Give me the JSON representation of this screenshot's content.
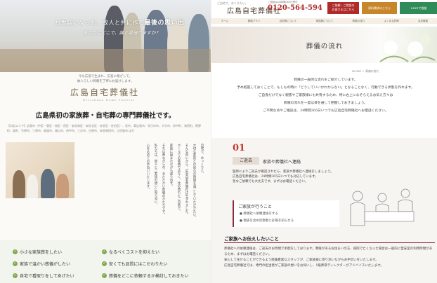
{
  "left": {
    "hero_copy_pre": "お世話になった、故人と共に作る",
    "hero_copy_em": "最後の思い出",
    "hero_copy_sub": "あなたはどこで、誰と見送りますか？",
    "intro_line1": "今も広島で生まれ、広島に根ざして、",
    "intro_line2": "故人らしい葬儀を丁寧にお届けします。",
    "logo": "広島自宅葬儀社",
    "logo_sub": "Hiroshima Home Funeral",
    "tagline": "広島県初の家族葬・自宅葬の専門葬儀社です。",
    "areas": "【対応エリア】広島市（中区・東区・南区・西区・安佐南区・安佐北区・安芸区・佐伯区）、呉市、東広島市、廿日市市、大竹市、府中町、海田町、熊野町、坂町、竹原市、三原市、尾道市、福山市、府中市、三次市、庄原市、安芸高田市、江田島市 ほか",
    "vertical_text": [
      "自宅で、ゆっくりと、",
      "大切な家族との別れの時間を過ごしていただきたい。",
      "そんな思いから、広島自宅葬儀社は生まれました。",
      "ホールでの葬儀ではなく、住み慣れたご自宅で、",
      "家族に囲まれながら送り出す。",
      "それは昔ながらの、あたたかい葬儀のかたちです。",
      "私たちは、故人とご家族の想いに寄り添い、",
      "心を込めてお手伝いいたします。"
    ],
    "checks": [
      "小さな家族葬をしたい",
      "なるべくコストを抑えたい",
      "家族で温かい葬儀がしたい",
      "安くても品質にはこだわりたい",
      "自宅で看取りをしてあげたい",
      "葬儀をどこに依頼するか検討しておきたい"
    ]
  },
  "right": {
    "logo_small": "ご自宅で、おくりたい。",
    "logo": "広島自宅葬儀社",
    "phone_note": "ご相談は24時間365日受付",
    "phone": "0120-564-594",
    "btn1_line1": "ご依頼・ご相談の",
    "btn1_line2": "お客さまはこちら",
    "btn2": "資料請求はこちら",
    "btn3": "LINEで相談",
    "nav": [
      "ホーム",
      "葬儀プラン",
      "自宅葬について",
      "家族葬について",
      "葬儀の流れ",
      "よくある質問",
      "会社概要"
    ],
    "banner_title": "葬儀の流れ",
    "breadcrumb": "HOME ＞ 葬儀の流れ",
    "lead": [
      "葬儀の一般的な流れをご紹介しています。",
      "予め把握しておくことで、もしもの時に「どうしていいかわからない」となることなく、行動できる状態を作れます。",
      "ご自身だけでなく親族やご家族様にも共有するため、特に右上になぞらえるお伝え方々は",
      "葬儀の流れを一度は目を通して把握しておきましょう。",
      "ご不明な点やご相談は、24時間365日いつでも広島自宅葬儀社へお電話ください。"
    ],
    "step_number": "01",
    "step_pill": "ご逝去",
    "step_title": "家族や葬儀社へ連絡",
    "step_body": [
      "医師によりご逝去が確認されたら、家族や葬儀社へ連絡をしましょう。",
      "広島自宅葬儀社は、24時間365日いつでも対応しています。",
      "急なご依頼でも大丈夫です。まずはお電話ください。"
    ],
    "box_title": "ご家族が行うこと",
    "box_items": [
      "葬儀社へ依頼連絡をする",
      "親族を含め近親者に訃報を知らせる"
    ],
    "section_title": "ご家族へお伝えしたいこと",
    "section_body": [
      "葬儀社への依頼連絡は、ご逝去のお時間で手配をしております。寒暖があるお住まいの方、病院で亡くなった場合は一般的に霊安室の利用時間があるため、まずはお電話ください。",
      "安心して任せることができるよう経験豊富なスタッフが、ご家族様に寄り添いながらお手伝いをいたします。",
      "広島自宅葬儀社では、専門の担当者がご家族の想いをお伺いし、1級葬祭ディレクターがアドバイスいたします。"
    ]
  }
}
